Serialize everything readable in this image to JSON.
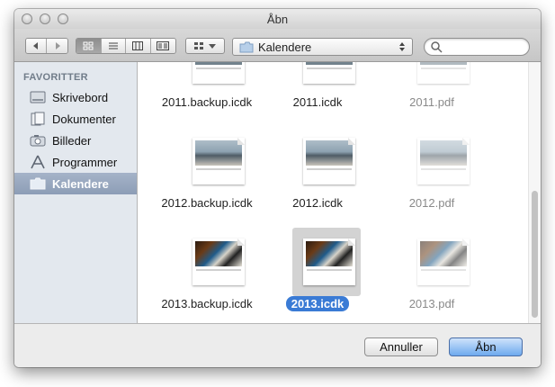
{
  "window": {
    "title": "Åbn"
  },
  "toolbar": {
    "path": {
      "label": "Kalendere",
      "icon": "folder-icon"
    },
    "search": {
      "placeholder": ""
    }
  },
  "sidebar": {
    "header": "FAVORITTER",
    "items": [
      {
        "label": "Skrivebord",
        "icon": "desktop-icon",
        "selected": false
      },
      {
        "label": "Dokumenter",
        "icon": "documents-icon",
        "selected": false
      },
      {
        "label": "Billeder",
        "icon": "camera-icon",
        "selected": false
      },
      {
        "label": "Programmer",
        "icon": "applications-icon",
        "selected": false
      },
      {
        "label": "Kalendere",
        "icon": "folder-icon",
        "selected": true
      }
    ]
  },
  "files": [
    {
      "name": "2011.backup.icdk",
      "dimmed": false,
      "selected": false,
      "thumb": "partial"
    },
    {
      "name": "2011.icdk",
      "dimmed": false,
      "selected": false,
      "thumb": "partial"
    },
    {
      "name": "2011.pdf",
      "dimmed": true,
      "selected": false,
      "thumb": "partial"
    },
    {
      "name": "2012.backup.icdk",
      "dimmed": false,
      "selected": false,
      "thumb": "stones"
    },
    {
      "name": "2012.icdk",
      "dimmed": false,
      "selected": false,
      "thumb": "stones"
    },
    {
      "name": "2012.pdf",
      "dimmed": true,
      "selected": false,
      "thumb": "stones"
    },
    {
      "name": "2013.backup.icdk",
      "dimmed": false,
      "selected": false,
      "thumb": "piano"
    },
    {
      "name": "2013.icdk",
      "dimmed": false,
      "selected": true,
      "thumb": "piano"
    },
    {
      "name": "2013.pdf",
      "dimmed": true,
      "selected": false,
      "thumb": "piano"
    }
  ],
  "buttons": {
    "cancel": "Annuller",
    "open": "Åbn"
  },
  "colors": {
    "selection": "#3a7bd5",
    "sidebar_bg": "#e3e8ee",
    "primary_button": "#6da9ee"
  }
}
